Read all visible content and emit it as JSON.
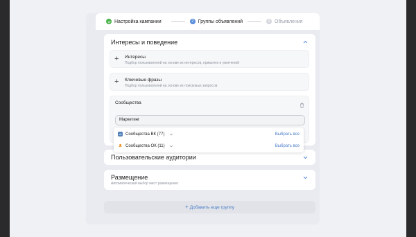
{
  "stepper": {
    "steps": [
      {
        "label": "Настройка кампании",
        "state": "done"
      },
      {
        "label": "Группы объявлений",
        "state": "active",
        "number": "2"
      },
      {
        "label": "Объявления",
        "state": "idle",
        "number": "3"
      }
    ]
  },
  "interests_section": {
    "title": "Интересы и поведение",
    "interests": {
      "title": "Интересы",
      "description": "Подбор пользователей на основе их интересов, привычек и увлечений"
    },
    "keywords": {
      "title": "Ключевые фразы",
      "description": "Подбор пользователей на основе их поисковых запросов"
    },
    "communities": {
      "title": "Сообщества",
      "search_value": "Маркетинг",
      "options": [
        {
          "label": "Сообщества ВК (77)",
          "action": "Выбрать все",
          "icon": "vk-icon"
        },
        {
          "label": "Сообщества ОК (11)",
          "action": "Выбрать все",
          "icon": "ok-icon"
        }
      ]
    }
  },
  "custom_audiences": {
    "title": "Пользовательские аудитории"
  },
  "placement": {
    "title": "Размещение",
    "description": "Автоматический выбор мест размещения"
  },
  "add_group_label": "Добавить еще группу",
  "colors": {
    "accent": "#5b8ddc",
    "done": "#4bb34b",
    "link": "#4a7cc9"
  }
}
